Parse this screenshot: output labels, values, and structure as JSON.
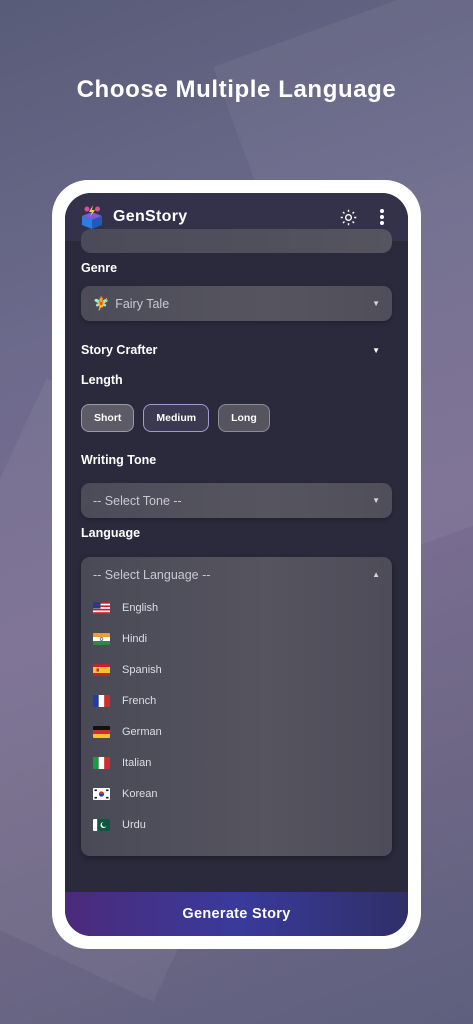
{
  "headline": "Choose Multiple Language",
  "app": {
    "title": "GenStory"
  },
  "form": {
    "genre_label": "Genre",
    "genre_value": "Fairy Tale",
    "genre_emoji": "🧚",
    "crafter_label": "Story Crafter",
    "length_label": "Length",
    "length_options": [
      "Short",
      "Medium",
      "Long"
    ],
    "tone_label": "Writing Tone",
    "tone_placeholder": "-- Select Tone --",
    "language_label": "Language",
    "language_placeholder": "-- Select Language --",
    "languages": [
      {
        "name": "English",
        "flag": "us-flag"
      },
      {
        "name": "Hindi",
        "flag": "india-flag"
      },
      {
        "name": "Spanish",
        "flag": "spain-flag"
      },
      {
        "name": "French",
        "flag": "france-flag"
      },
      {
        "name": "German",
        "flag": "germany-flag"
      },
      {
        "name": "Italian",
        "flag": "italy-flag"
      },
      {
        "name": "Korean",
        "flag": "korea-flag"
      },
      {
        "name": "Urdu",
        "flag": "pakistan-flag"
      }
    ]
  },
  "generate_button": "Generate Story",
  "colors": {
    "accent": "#3a3a9c",
    "accent_purple": "#4b2a7a",
    "surface": "#2b2a3c"
  }
}
